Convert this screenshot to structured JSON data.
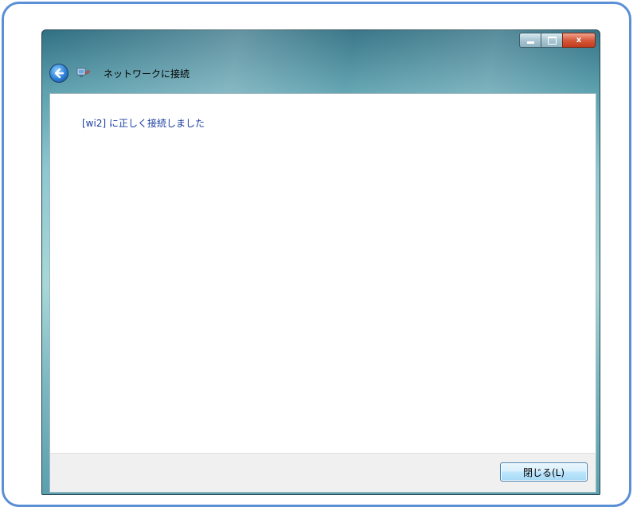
{
  "window": {
    "title": "ネットワークに接続"
  },
  "caption_buttons": {
    "close_glyph": "x"
  },
  "content": {
    "message": "[wi2] に正しく接続しました"
  },
  "footer": {
    "close_button_label": "閉じる(L)"
  },
  "colors": {
    "frame_border": "#5b8fd6",
    "message_text": "#1a3ea0",
    "close_caption": "#c23c1d"
  },
  "icons": [
    "back-arrow-icon",
    "network-icon",
    "minimize-icon",
    "maximize-icon",
    "close-icon"
  ]
}
